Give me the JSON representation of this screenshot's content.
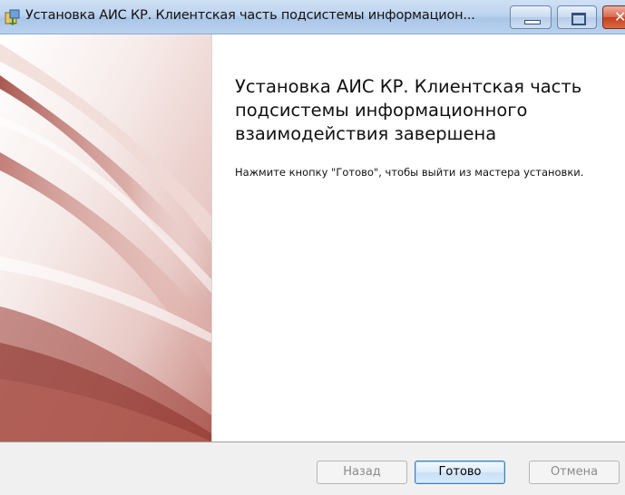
{
  "window": {
    "title": "Установка АИС КР. Клиентская часть подсистемы информацион...",
    "icons": {
      "app": "installer-icon",
      "minimize": "minimize-icon",
      "maximize": "maximize-icon",
      "close": "close-icon"
    },
    "close_glyph": "✕"
  },
  "main": {
    "heading": "Установка АИС КР. Клиентская часть подсистемы информационного взаимодействия завершена",
    "description": "Нажмите кнопку \"Готово\", чтобы выйти из мастера установки."
  },
  "buttons": {
    "back": "Назад",
    "finish": "Готово",
    "cancel": "Отмена"
  },
  "colors": {
    "banner_accent": "#9b3c34",
    "titlebar": "#bdd3ee",
    "close_button": "#c4401e"
  }
}
